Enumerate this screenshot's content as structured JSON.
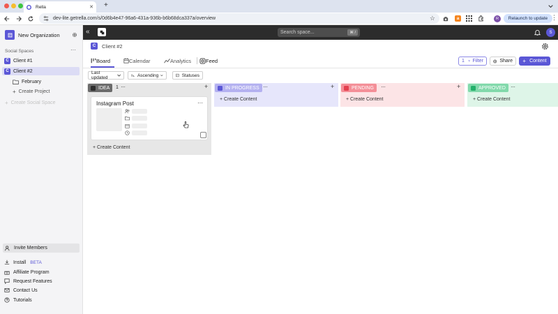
{
  "browser": {
    "tab_title": "Rella",
    "url": "dev-lite.getrella.com/s/0d6b4e47-96a6-431a-936b-b6b68dca337a/overview",
    "relaunch_label": "Relaunch to update",
    "profile_initial": "R"
  },
  "sidebar": {
    "org_name": "New Organization",
    "section_label": "Social Spaces",
    "spaces": [
      {
        "badge": "C",
        "label": "Client #1"
      },
      {
        "badge": "C",
        "label": "Client #2"
      }
    ],
    "folder_label": "February",
    "create_project": "Create Project",
    "create_space": "Create Social Space",
    "invite_members": "Invite Members",
    "install_label": "Install",
    "beta_badge": "BETA",
    "links": [
      "Affiliate Program",
      "Request Features",
      "Contact Us",
      "Tutorials"
    ]
  },
  "app_top": {
    "search_placeholder": "Search space...",
    "search_shortcut": "⌘ /",
    "avatar_initial": "S"
  },
  "header": {
    "badge": "C",
    "title": "Client #2",
    "tabs": [
      "Board",
      "Calendar",
      "Analytics",
      "Feed"
    ],
    "filter_count": "1",
    "filter_label": "Filter",
    "share_label": "Share",
    "content_label": "Content"
  },
  "filters": {
    "sort_field": "Last updated",
    "sort_order": "Ascending",
    "statuses": "Statuses"
  },
  "board": {
    "columns": [
      {
        "label": "IDEA",
        "count": "1",
        "color": "#3a3a3a",
        "create": "+ Create Content"
      },
      {
        "label": "IN PROGRESS",
        "color": "#6a66e0",
        "create": "+ Create Content"
      },
      {
        "label": "PENDING",
        "color": "#ee5b68",
        "create": "+ Create Content"
      },
      {
        "label": "APPROVED",
        "color": "#34c27a",
        "create": "+ Create Content"
      }
    ],
    "card": {
      "title": "Instagram Post"
    }
  }
}
